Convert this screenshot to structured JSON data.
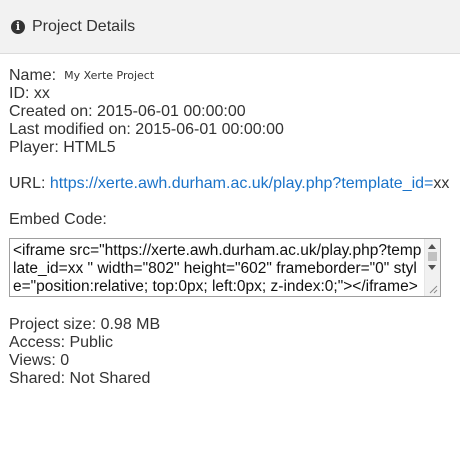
{
  "header": {
    "icon": "info-circle-icon",
    "title": "Project Details"
  },
  "details": {
    "name_label": "Name:",
    "name_value": "My Xerte Project",
    "id": "ID: xx",
    "created": "Created on: 2015-06-01 00:00:00",
    "modified": "Last modified on: 2015-06-01 00:00:00",
    "player": "Player: HTML5"
  },
  "url": {
    "label": "URL: ",
    "link": "https://xerte.awh.durham.ac.uk/play.php?template_id=",
    "suffix": "xx"
  },
  "embed": {
    "label": "Embed Code:",
    "code": "<iframe src=\"https://xerte.awh.durham.ac.uk/play.php?template_id=xx  \" width=\"802\" height=\"602\" frameborder=\"0\" style=\"position:relative; top:0px; left:0px; z-index:0;\"></iframe>"
  },
  "stats": {
    "size": "Project size: 0.98 MB",
    "access": "Access: Public",
    "views": "Views: 0",
    "shared": "Shared: Not Shared"
  },
  "colors": {
    "link": "#1a73c9",
    "header_bg": "#f2f2f2",
    "text": "#333333"
  }
}
